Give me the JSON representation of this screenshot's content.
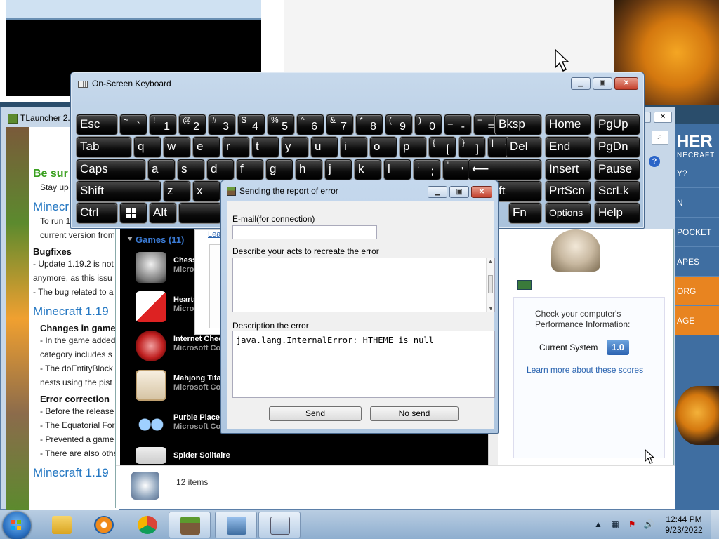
{
  "background": {
    "tlauncher": {
      "title": "TLauncher 2.8",
      "heading_green": "Be sur",
      "line1": "Stay up",
      "h_minecraft1": "Minecr",
      "p1": "To run 1.19, you nee",
      "p2": "current version from",
      "bugfixes": "Bugfixes",
      "b1": "- Update 1.19.2 is not",
      "b2": "anymore, as this issu",
      "b3": "- The bug related to a",
      "h_minecraft2": "Minecraft 1.19",
      "changes": "Changes in game",
      "c1": "- In the game added",
      "c2": "category includes s",
      "c3": "- The doEntityBlock",
      "c4": "nests using the pist",
      "error_correction": "Error correction",
      "e1": "- Before the release",
      "e2": "- The Equatorial For",
      "e3": "- Prevented a game",
      "e4": "- There are also othe",
      "h_minecraft3": "Minecraft 1.19",
      "right_logo": "HER",
      "right_logo_sub": "NECRAFT",
      "right_items": [
        "Y?",
        "N",
        "POCKET",
        "APES",
        "ORG",
        "AGE"
      ]
    },
    "games": {
      "header": "Games (11)",
      "items": [
        {
          "name": "Chess",
          "publisher": "Micros"
        },
        {
          "name": "Hearts",
          "publisher": "Micros"
        },
        {
          "name": "Internet Chec",
          "publisher": "Microsoft Co"
        },
        {
          "name": "Mahjong Tita",
          "publisher": "Microsoft Co"
        },
        {
          "name": "Purble Place",
          "publisher": "Microsoft Co"
        },
        {
          "name": "Spider Solitaire",
          "publisher": ""
        }
      ],
      "partial_link": "Lea",
      "perf_text": "Check your computer's Performance Information:",
      "current_system": "Current System",
      "score": "1.0",
      "learn_more": "Learn more about these scores",
      "item_count": "12 items"
    }
  },
  "osk": {
    "title": "On-Screen Keyboard",
    "rows": [
      [
        [
          "Esc",
          "",
          ""
        ],
        [
          "",
          "~",
          "`"
        ],
        [
          "",
          "!",
          "1"
        ],
        [
          "",
          "@",
          "2"
        ],
        [
          "",
          "#",
          "3"
        ],
        [
          "",
          "$",
          "4"
        ],
        [
          "",
          "%",
          "5"
        ],
        [
          "",
          "^",
          "6"
        ],
        [
          "",
          "&",
          "7"
        ],
        [
          "",
          "*",
          "8"
        ],
        [
          "",
          "(",
          "9"
        ],
        [
          "",
          ")",
          "0"
        ],
        [
          "",
          "_",
          "-"
        ],
        [
          "",
          "+",
          "="
        ],
        [
          "Bksp",
          "",
          ""
        ],
        [
          "Home",
          "",
          ""
        ],
        [
          "PgUp",
          "",
          ""
        ]
      ],
      [
        [
          "Tab",
          "",
          ""
        ],
        [
          "q",
          "",
          ""
        ],
        [
          "w",
          "",
          ""
        ],
        [
          "e",
          "",
          ""
        ],
        [
          "r",
          "",
          ""
        ],
        [
          "t",
          "",
          ""
        ],
        [
          "y",
          "",
          ""
        ],
        [
          "u",
          "",
          ""
        ],
        [
          "i",
          "",
          ""
        ],
        [
          "o",
          "",
          ""
        ],
        [
          "p",
          "",
          ""
        ],
        [
          "",
          "{",
          "["
        ],
        [
          "",
          "}",
          "]"
        ],
        [
          "",
          "|",
          "\\"
        ],
        [
          "Del",
          "",
          ""
        ],
        [
          "End",
          "",
          ""
        ],
        [
          "PgDn",
          "",
          ""
        ]
      ],
      [
        [
          "Caps",
          "",
          ""
        ],
        [
          "a",
          "",
          ""
        ],
        [
          "s",
          "",
          ""
        ],
        [
          "d",
          "",
          ""
        ],
        [
          "f",
          "",
          ""
        ],
        [
          "g",
          "",
          ""
        ],
        [
          "h",
          "",
          ""
        ],
        [
          "j",
          "",
          ""
        ],
        [
          "k",
          "",
          ""
        ],
        [
          "l",
          "",
          ""
        ],
        [
          "",
          ":",
          ";"
        ],
        [
          "",
          "\"",
          "'"
        ],
        [
          "⟵",
          "",
          ""
        ],
        [
          "Insert",
          "",
          ""
        ],
        [
          "Pause",
          "",
          ""
        ]
      ],
      [
        [
          "Shift",
          "",
          ""
        ],
        [
          "z",
          "",
          ""
        ],
        [
          "x",
          "",
          ""
        ],
        [
          "ft",
          "",
          ""
        ],
        [
          "PrtScn",
          "",
          ""
        ],
        [
          "ScrLk",
          "",
          ""
        ]
      ],
      [
        [
          "Ctrl",
          "",
          ""
        ],
        [
          "",
          "",
          ""
        ],
        [
          "Alt",
          "",
          ""
        ],
        [
          "",
          "",
          ""
        ],
        [
          "Fn",
          "",
          ""
        ],
        [
          "Options",
          "",
          ""
        ],
        [
          "Help",
          "",
          ""
        ]
      ]
    ]
  },
  "error_dialog": {
    "title": "Sending the report of error",
    "email_label": "E-mail(for connection)",
    "email_value": "",
    "describe_label": "Describe your acts to recreate the error",
    "describe_value": "",
    "description_label": "Description the error",
    "description_value": "java.lang.InternalError: HTHEME is null",
    "send_label": "Send",
    "nosend_label": "No send"
  },
  "taskbar": {
    "time": "12:44 PM",
    "date": "9/23/2022",
    "apps": [
      "explorer-icon",
      "media-player-icon",
      "chrome-icon",
      "minecraft-icon",
      "games-explorer-icon",
      "on-screen-keyboard-icon"
    ]
  }
}
